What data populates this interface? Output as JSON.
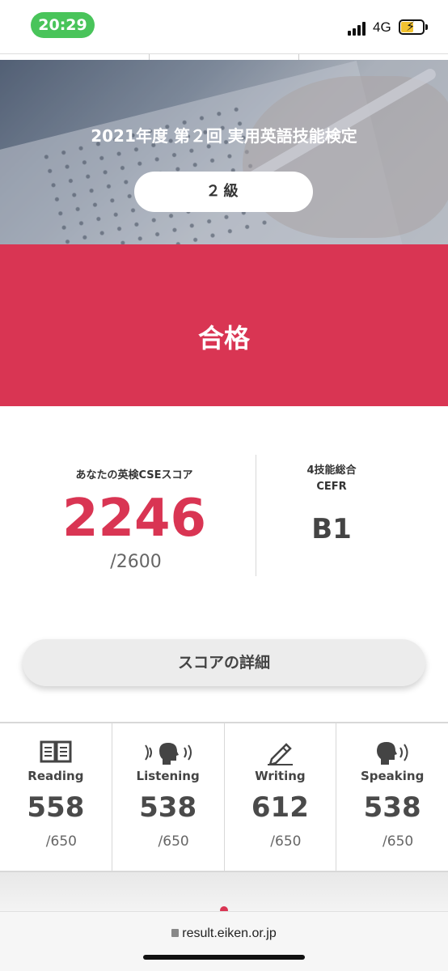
{
  "status_bar": {
    "time": "20:29",
    "network": "4G",
    "battery_icon": "battery-charging-icon",
    "signal_icon": "signal-bars-icon",
    "time_pill_color": "#49c45a"
  },
  "hero": {
    "title": "2021年度 第２回 実用英語技能検定",
    "grade": "２級"
  },
  "result": {
    "label": "合格",
    "band_color": "#d93553"
  },
  "score": {
    "label": "あなたの英検CSEスコア",
    "value": "2246",
    "max": "/2600",
    "cefr_label_line1": "4技能総合",
    "cefr_label_line2": "CEFR",
    "cefr_value": "B1"
  },
  "detail_button": {
    "label": "スコアの詳細"
  },
  "skills": [
    {
      "name": "Reading",
      "score": "558",
      "max": "/650",
      "icon": "book-icon"
    },
    {
      "name": "Listening",
      "score": "538",
      "max": "/650",
      "icon": "listening-head-icon"
    },
    {
      "name": "Writing",
      "score": "612",
      "max": "/650",
      "icon": "pencil-icon"
    },
    {
      "name": "Speaking",
      "score": "538",
      "max": "/650",
      "icon": "speaking-head-icon"
    }
  ],
  "browser": {
    "url": "result.eiken.or.jp"
  }
}
